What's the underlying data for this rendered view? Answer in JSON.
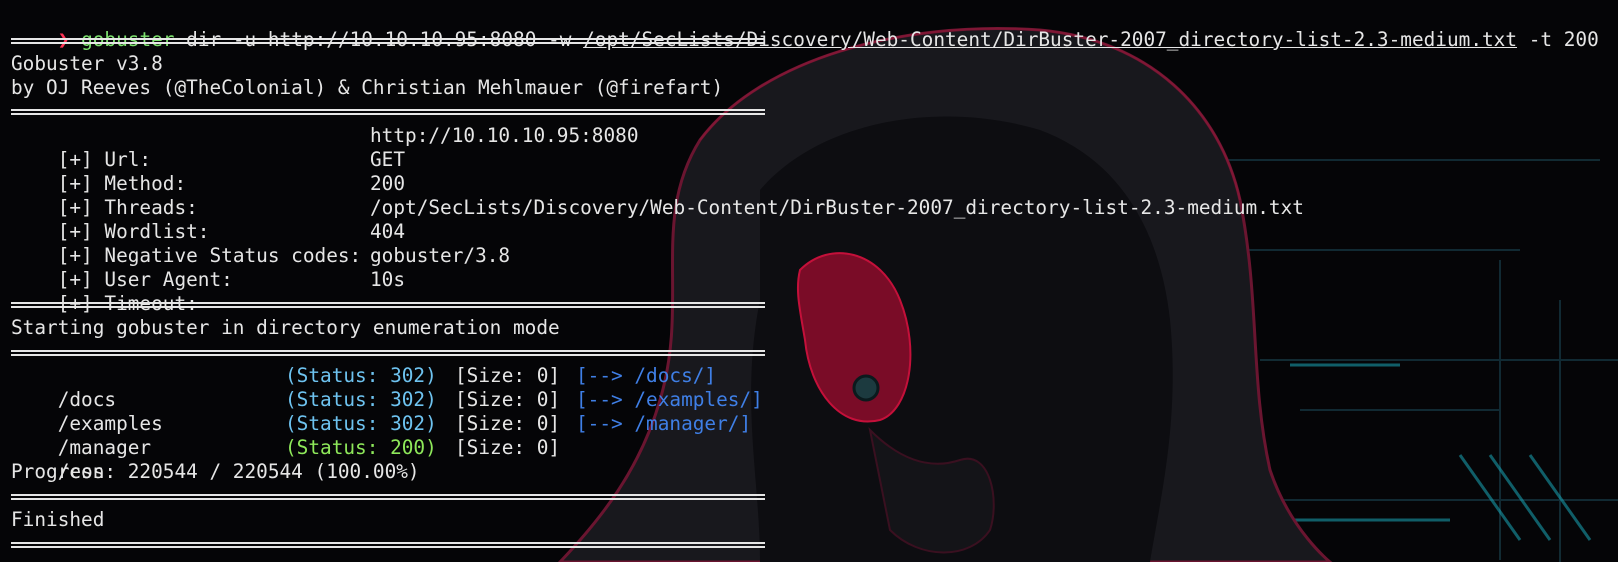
{
  "command": {
    "prompt_symbol": "❯",
    "program": "gobuster",
    "args_before_path": " dir -u http://10.10.10.95:8080 -w ",
    "wordlist_path": "/opt/SecLists/Discovery/Web-Content/DirBuster-2007_directory-list-2.3-medium.txt",
    "args_after_path": " -t 200"
  },
  "banner": {
    "version_line": "Gobuster v3.8",
    "author_line": "by OJ Reeves (@TheColonial) & Christian Mehlmauer (@firefart)"
  },
  "config": [
    {
      "label": "[+] Url:",
      "value": "http://10.10.10.95:8080"
    },
    {
      "label": "[+] Method:",
      "value": "GET"
    },
    {
      "label": "[+] Threads:",
      "value": "200"
    },
    {
      "label": "[+] Wordlist:",
      "value": "/opt/SecLists/Discovery/Web-Content/DirBuster-2007_directory-list-2.3-medium.txt"
    },
    {
      "label": "[+] Negative Status codes:",
      "value": "404"
    },
    {
      "label": "[+] User Agent:",
      "value": "gobuster/3.8"
    },
    {
      "label": "[+] Timeout:",
      "value": "10s"
    }
  ],
  "mode_line": "Starting gobuster in directory enumeration mode",
  "results": [
    {
      "path": "/docs",
      "status": "(Status: 302)",
      "size": "[Size: 0]",
      "redirect": "[--> /docs/]"
    },
    {
      "path": "/examples",
      "status": "(Status: 302)",
      "size": "[Size: 0]",
      "redirect": "[--> /examples/]"
    },
    {
      "path": "/manager",
      "status": "(Status: 302)",
      "size": "[Size: 0]",
      "redirect": "[--> /manager/]"
    },
    {
      "path": "/con",
      "status": "(Status: 200)",
      "size": "[Size: 0]",
      "redirect": ""
    }
  ],
  "progress_line": "Progress: 220544 / 220544 (100.00%)",
  "finished_line": "Finished",
  "colors": {
    "background": "#050507",
    "text": "#e6e6e6",
    "prompt": "#ff3355",
    "command": "#7ee26f",
    "status_redirect": "#6ec3f0",
    "status_ok": "#8ee85a",
    "redirect_link": "#3f7fe6",
    "art_accent": "#c4103a",
    "art_teal": "#1aa7b8"
  },
  "background_art": "hooded-figure-gas-mask-wallpaper"
}
